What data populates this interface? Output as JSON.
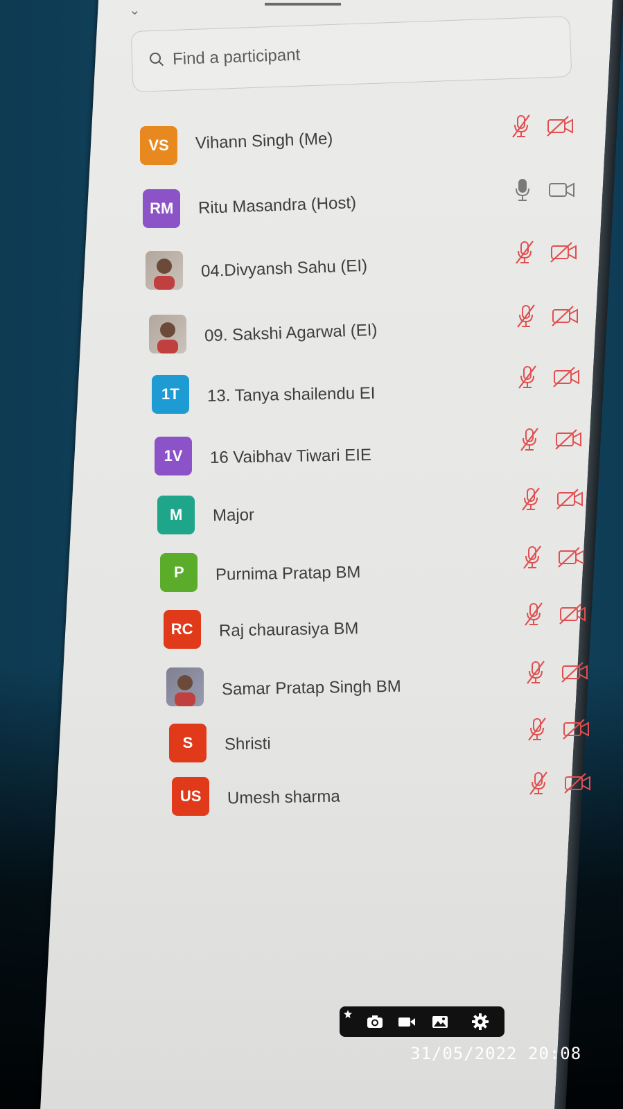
{
  "search": {
    "placeholder": "Find a participant"
  },
  "participants": [
    {
      "initials": "VS",
      "name": "Vihann Singh (Me)",
      "color": "#e8891f",
      "photo": false,
      "mic": "muted",
      "cam": "off"
    },
    {
      "initials": "RM",
      "name": "Ritu Masandra (Host)",
      "color": "#8c52c7",
      "photo": false,
      "mic": "on",
      "cam": "on"
    },
    {
      "initials": "",
      "name": "04.Divyansh Sahu (EI)",
      "color": "#b0a8a0",
      "photo": true,
      "mic": "muted",
      "cam": "off"
    },
    {
      "initials": "",
      "name": "09. Sakshi Agarwal (EI)",
      "color": "#b0a8a0",
      "photo": true,
      "mic": "muted",
      "cam": "off"
    },
    {
      "initials": "1T",
      "name": "13. Tanya shailendu EI",
      "color": "#1e9bd2",
      "photo": false,
      "mic": "muted",
      "cam": "off"
    },
    {
      "initials": "1V",
      "name": "16 Vaibhav Tiwari EIE",
      "color": "#8c52c7",
      "photo": false,
      "mic": "muted",
      "cam": "off"
    },
    {
      "initials": "M",
      "name": "Major",
      "color": "#1ea58a",
      "photo": false,
      "mic": "muted",
      "cam": "off"
    },
    {
      "initials": "P",
      "name": "Purnima Pratap BM",
      "color": "#5aac2a",
      "photo": false,
      "mic": "muted",
      "cam": "off"
    },
    {
      "initials": "RC",
      "name": "Raj chaurasiya BM",
      "color": "#e03a1a",
      "photo": false,
      "mic": "muted",
      "cam": "off"
    },
    {
      "initials": "",
      "name": "Samar Pratap Singh BM",
      "color": "#4a5a8a",
      "photo": true,
      "mic": "muted",
      "cam": "off"
    },
    {
      "initials": "S",
      "name": "Shristi",
      "color": "#e03a1a",
      "photo": false,
      "mic": "muted",
      "cam": "off"
    },
    {
      "initials": "US",
      "name": "Umesh sharma",
      "color": "#e03a1a",
      "photo": false,
      "mic": "muted",
      "cam": "off"
    }
  ],
  "timestamp": "31/05/2022 20:08",
  "colors": {
    "muted_icon": "#e05050",
    "active_icon": "#7a7a7a"
  }
}
